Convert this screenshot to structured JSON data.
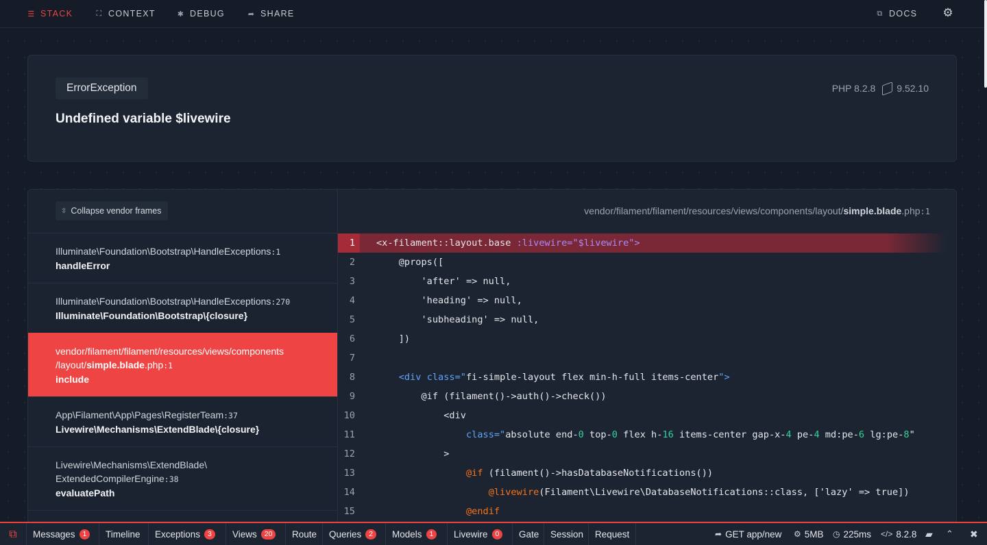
{
  "nav": {
    "items": [
      {
        "label": "STACK",
        "icon": "stack-icon"
      },
      {
        "label": "CONTEXT",
        "icon": "context-icon"
      },
      {
        "label": "DEBUG",
        "icon": "bug-icon"
      },
      {
        "label": "SHARE",
        "icon": "share-icon"
      }
    ],
    "docs_label": "DOCS",
    "settings_icon": "gear-icon"
  },
  "exception": {
    "class": "ErrorException",
    "message": "Undefined variable $livewire",
    "php_version": "PHP 8.2.8",
    "laravel_version": "9.52.10"
  },
  "frames_panel": {
    "collapse_label": "Collapse vendor frames",
    "frames": [
      {
        "class": "Illuminate\\Foundation\\Bootstrap\\HandleExceptions",
        "line": ":1",
        "function": "handleError"
      },
      {
        "class": "Illuminate\\Foundation\\Bootstrap\\HandleExceptions",
        "line": ":270",
        "function": "Illuminate\\Foundation\\Bootstrap\\{closure}"
      },
      {
        "path_prefix": "vendor/filament/filament/resources/views/components",
        "path_mid": "/layout/",
        "file": "simple.blade",
        "ext": ".php",
        "line": ":1",
        "function": "include"
      },
      {
        "class": "App\\Filament\\App\\Pages\\RegisterTeam",
        "line": ":37",
        "function": "Livewire\\Mechanisms\\ExtendBlade\\{closure}"
      },
      {
        "class_line1": "Livewire\\Mechanisms\\ExtendBlade\\",
        "class_line2": "ExtendedCompilerEngine",
        "line": ":38",
        "function": "evaluatePath"
      }
    ]
  },
  "code": {
    "path_prefix": "vendor/filament/filament/resources/views/components/layout/",
    "file": "simple.blade",
    "ext": ".php",
    "line": ":1",
    "line_numbers": [
      "1",
      "2",
      "3",
      "4",
      "5",
      "6",
      "7",
      "8",
      "9",
      "10",
      "11",
      "12",
      "13",
      "14",
      "15"
    ],
    "highlighted_line": "1"
  },
  "debugbar": {
    "tabs": [
      {
        "label": "Messages",
        "badge": "1"
      },
      {
        "label": "Timeline",
        "badge": ""
      },
      {
        "label": "Exceptions",
        "badge": "3"
      },
      {
        "label": "Views",
        "badge": "20"
      },
      {
        "label": "Route",
        "badge": ""
      },
      {
        "label": "Queries",
        "badge": "2"
      },
      {
        "label": "Models",
        "badge": "1"
      },
      {
        "label": "Livewire",
        "badge": "0"
      },
      {
        "label": "Gate",
        "badge": ""
      },
      {
        "label": "Session",
        "badge": ""
      },
      {
        "label": "Request",
        "badge": ""
      }
    ],
    "request": "GET app/new",
    "memory": "5MB",
    "time": "225ms",
    "php": "8.2.8"
  },
  "colors": {
    "accent": "#ef4444",
    "background": "#151c27",
    "card": "#1c2431"
  }
}
